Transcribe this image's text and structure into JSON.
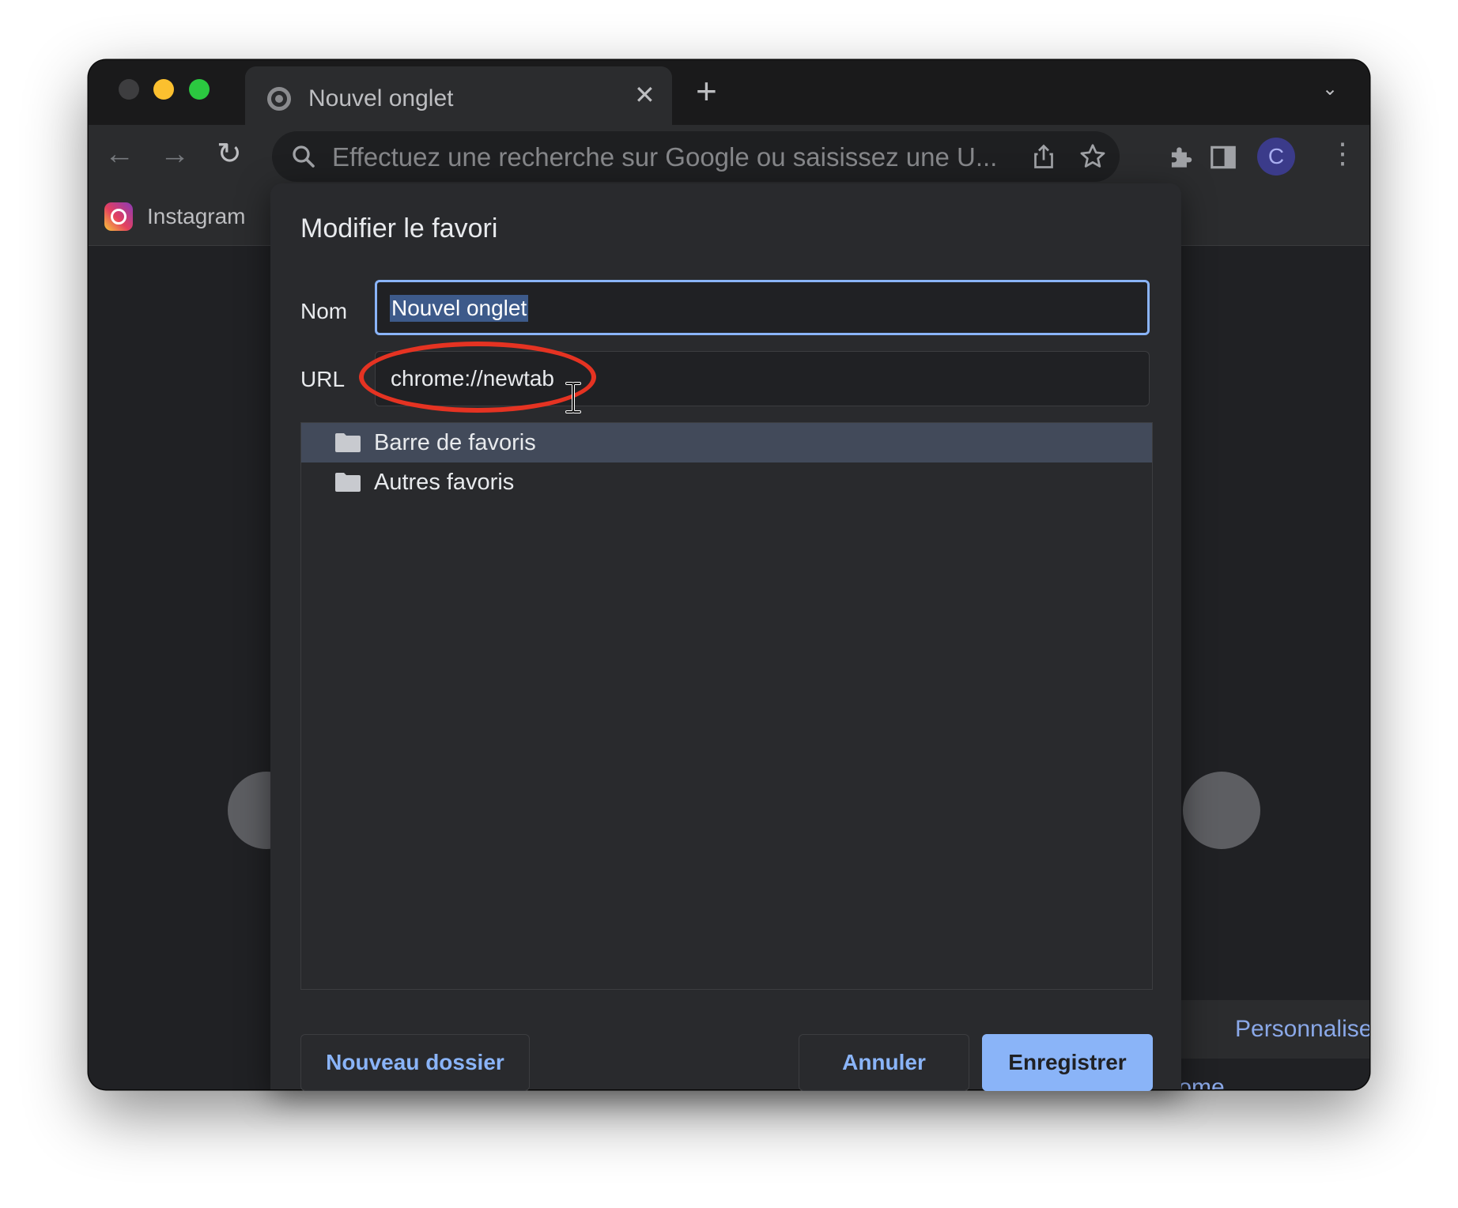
{
  "browser": {
    "tab": {
      "title": "Nouvel onglet",
      "close_glyph": "✕"
    },
    "new_tab_glyph": "+",
    "tab_menu_glyph": "⌄",
    "nav": {
      "back_glyph": "←",
      "forward_glyph": "→",
      "reload_glyph": "↻"
    },
    "omnibox": {
      "placeholder": "Effectuez une recherche sur Google ou saisissez une U..."
    },
    "profile_initial": "C",
    "menu_glyph": "⋮"
  },
  "bookmarks_bar": {
    "items": [
      {
        "label": "Instagram",
        "icon": "instagram-icon"
      }
    ]
  },
  "ntp": {
    "customize_label": "Personnaliser Chrome"
  },
  "dialog": {
    "title": "Modifier le favori",
    "name": {
      "label": "Nom",
      "value": "Nouvel onglet"
    },
    "url": {
      "label": "URL",
      "value": "chrome://newtab"
    },
    "folders": [
      {
        "label": "Barre de favoris",
        "selected": true
      },
      {
        "label": "Autres favoris",
        "selected": false
      }
    ],
    "buttons": {
      "new_folder": "Nouveau dossier",
      "cancel": "Annuler",
      "save": "Enregistrer"
    }
  },
  "colors": {
    "accent": "#8ab4f8",
    "annotation_red": "#e53322",
    "selection": "#3d5a8a",
    "tree_selected": "#424a5a"
  }
}
